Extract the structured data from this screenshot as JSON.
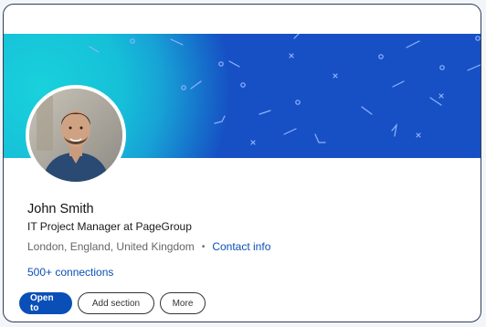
{
  "profile": {
    "name": "John Smith",
    "headline": "IT Project Manager at PageGroup",
    "location": "London, England, United Kingdom",
    "separator": "•",
    "contact_label": "Contact info",
    "connections": "500+ connections"
  },
  "actions": {
    "open_to": "Open to",
    "add_section": "Add section",
    "more": "More"
  },
  "colors": {
    "accent": "#0a4fb7",
    "banner": "#1650c4",
    "banner_glow": "#19d1dc"
  }
}
